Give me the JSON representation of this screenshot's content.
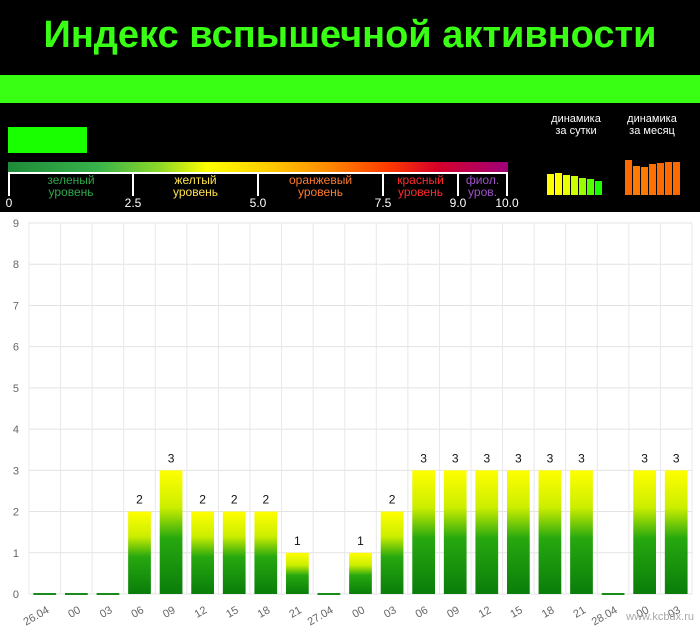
{
  "header": {
    "title": "Индекс вспышечной активности",
    "colors": {
      "title": "#39ff14",
      "band": "#39ff14",
      "current_level_box": "#1aff00",
      "background": "#000000"
    },
    "scale": {
      "segments": [
        {
          "line1": "зеленый",
          "line2": "уровень",
          "color": "#2ea84a"
        },
        {
          "line1": "желтый",
          "line2": "уровень",
          "color": "#ffe14a"
        },
        {
          "line1": "оранжевый",
          "line2": "уровень",
          "color": "#ff7a2e"
        },
        {
          "line1": "красный",
          "line2": "уровень",
          "color": "#ff2a2a"
        },
        {
          "line1": "фиол.",
          "line2": "уров.",
          "color": "#a050c8"
        }
      ],
      "ticks": [
        "0",
        "2.5",
        "5.0",
        "7.5",
        "9.0",
        "10.0"
      ]
    },
    "dynamics_day": {
      "label_line1": "динамика",
      "label_line2": "за сутки"
    },
    "dynamics_month": {
      "label_line1": "динамика",
      "label_line2": "за месяц"
    }
  },
  "chart_data": {
    "type": "bar",
    "categories": [
      "26.04",
      "00",
      "03",
      "06",
      "09",
      "12",
      "15",
      "18",
      "21",
      "27.04",
      "00",
      "03",
      "06",
      "09",
      "12",
      "15",
      "18",
      "21",
      "28.04",
      "00",
      "03"
    ],
    "values": [
      0,
      0,
      0,
      2,
      3,
      2,
      2,
      2,
      1,
      0,
      1,
      2,
      3,
      3,
      3,
      3,
      3,
      3,
      0,
      3,
      3
    ],
    "data_labels": [
      "",
      "",
      "",
      "2",
      "3",
      "2",
      "2",
      "2",
      "1",
      "",
      "1",
      "2",
      "3",
      "3",
      "3",
      "3",
      "3",
      "3",
      "",
      "3",
      "3"
    ],
    "ylim": [
      0,
      9
    ],
    "yticks": [
      "0",
      "1",
      "2",
      "3",
      "4",
      "5",
      "6",
      "7",
      "8",
      "9"
    ],
    "grid": true,
    "bar_gradient": {
      "top": "#ffff00",
      "bottom": "#0a7d0a"
    }
  },
  "watermark": "www.kcbdx.ru"
}
